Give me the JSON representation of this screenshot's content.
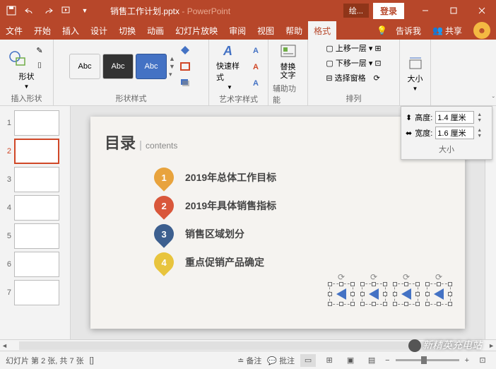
{
  "title": {
    "filename": "销售工作计划.pptx",
    "separator": " - ",
    "app": "PowerPoint"
  },
  "titlebar": {
    "drawing_tools": "绘...",
    "login": "登录"
  },
  "tabs": [
    "文件",
    "开始",
    "插入",
    "设计",
    "切换",
    "动画",
    "幻灯片放映",
    "审阅",
    "视图",
    "帮助",
    "格式"
  ],
  "tellme": "告诉我",
  "share": "共享",
  "ribbon": {
    "insert_shapes": {
      "label": "插入形状",
      "shapes_btn": "形状"
    },
    "shape_styles": {
      "label": "形状样式",
      "preset": "Abc"
    },
    "wordart": {
      "label": "艺术字样式",
      "quick": "快速样式"
    },
    "accessibility": {
      "label": "辅助功能",
      "alt_text": "替换\n文字"
    },
    "arrange": {
      "label": "排列",
      "bring_forward": "上移一层",
      "send_backward": "下移一层",
      "selection_pane": "选择窗格"
    },
    "size": {
      "label": "大小",
      "btn": "大小"
    }
  },
  "size_panel": {
    "height_label": "高度:",
    "height_value": "1.4 厘米",
    "width_label": "宽度:",
    "width_value": "1.6 厘米",
    "title": "大小"
  },
  "slide": {
    "toc_main": "目录",
    "toc_sub": "contents",
    "items": [
      {
        "num": "1",
        "text": "2019年总体工作目标",
        "color": "#e8a33d"
      },
      {
        "num": "2",
        "text": "2019年具体销售指标",
        "color": "#d9573b"
      },
      {
        "num": "3",
        "text": "销售区域划分",
        "color": "#3d5f8f"
      },
      {
        "num": "4",
        "text": "重点促销产品确定",
        "color": "#e8c43d"
      }
    ]
  },
  "thumbs": {
    "count": 7,
    "active": 2
  },
  "status": {
    "slide_info": "幻灯片 第 2 张, 共 7 张",
    "lang": "",
    "notes": "备注",
    "comments": "批注",
    "zoom": "+"
  },
  "watermark": "新精英充电站"
}
